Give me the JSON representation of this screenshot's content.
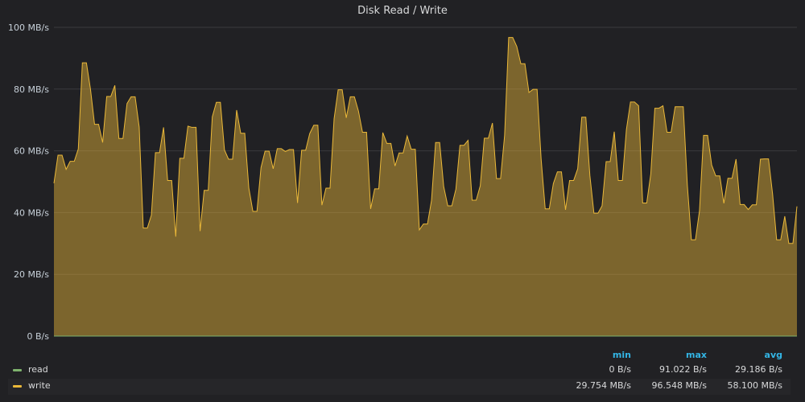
{
  "panel": {
    "title": "Disk Read / Write"
  },
  "legend": {
    "headers": {
      "min": "min",
      "max": "max",
      "avg": "avg"
    },
    "rows": [
      {
        "name": "read",
        "color": "#7eb26d",
        "min": "0 B/s",
        "max": "91.022 B/s",
        "avg": "29.186 B/s"
      },
      {
        "name": "write",
        "color": "#eab839",
        "min": "29.754 MB/s",
        "max": "96.548 MB/s",
        "avg": "58.100 MB/s"
      }
    ]
  },
  "chart_data": {
    "type": "area",
    "title": "Disk Read / Write",
    "ylabel": "",
    "ylim": [
      0,
      100
    ],
    "y_unit": "MB/s",
    "y_ticks": [
      "0 B/s",
      "20 MB/s",
      "40 MB/s",
      "60 MB/s",
      "80 MB/s",
      "100 MB/s"
    ],
    "grid": true,
    "legend_position": "bottom",
    "series": [
      {
        "name": "read",
        "color": "#7eb26d",
        "values": [
          0,
          0,
          0,
          0,
          0,
          0,
          0,
          0,
          0,
          0,
          0,
          0,
          0,
          0,
          0,
          0,
          0,
          0,
          0,
          0,
          0,
          0,
          0,
          0,
          0,
          0,
          0,
          0,
          0,
          0,
          0,
          0,
          0,
          0,
          0,
          0,
          0,
          0,
          0,
          0,
          0,
          0,
          0,
          0,
          0,
          0,
          0,
          0,
          0,
          0,
          0,
          0,
          0,
          0,
          0,
          0,
          0,
          0,
          0,
          0,
          0,
          0,
          0,
          0,
          0,
          0,
          0,
          0,
          0,
          0,
          0,
          0,
          0,
          0,
          0,
          0,
          0,
          0,
          0,
          0,
          0,
          0,
          0,
          0,
          0,
          0,
          0,
          0,
          0,
          0,
          0,
          0,
          0,
          0,
          0,
          0,
          0,
          0,
          0,
          0,
          0,
          0,
          0,
          0,
          0,
          0,
          0,
          0,
          0,
          0,
          0,
          0,
          0,
          0,
          0,
          0,
          0,
          0,
          0,
          0,
          0,
          0,
          0,
          0,
          0,
          0,
          0,
          0,
          0,
          0,
          0,
          0,
          0,
          0,
          0,
          0,
          0,
          0,
          0,
          0,
          0,
          0,
          0,
          0,
          0,
          0,
          0,
          0,
          0,
          0,
          0,
          0,
          0,
          0,
          0,
          0,
          0,
          0,
          0,
          0,
          0,
          0,
          0,
          0,
          0,
          0,
          0,
          0,
          0,
          0,
          0,
          0,
          0,
          0,
          0,
          0,
          0,
          0,
          0,
          0,
          0,
          0,
          0,
          0,
          0,
          0,
          0,
          0,
          0,
          0,
          0,
          0,
          0,
          0,
          0,
          0,
          0,
          0,
          0,
          0,
          0,
          0,
          0,
          0,
          0,
          0,
          0,
          0,
          0,
          0,
          0,
          0,
          0,
          0,
          0,
          0,
          0,
          0,
          0,
          0,
          0,
          0,
          0,
          0,
          0,
          0,
          0,
          0,
          0,
          0,
          0,
          0,
          0,
          0,
          0,
          0,
          0,
          0,
          0,
          0,
          0,
          0,
          0,
          0,
          0,
          0,
          0,
          0,
          0,
          0,
          0,
          0,
          0,
          0,
          0,
          0,
          0,
          0,
          0,
          0,
          0,
          0,
          0,
          0,
          0,
          0,
          0,
          0,
          0,
          0,
          0,
          0,
          0,
          0,
          0,
          0,
          0,
          0,
          0,
          0,
          0,
          0,
          0,
          0,
          0,
          0,
          0,
          0,
          0,
          0,
          0,
          0,
          0,
          0,
          0,
          0,
          0,
          0,
          0,
          0,
          0,
          0,
          0,
          0,
          0,
          0,
          0,
          0,
          0,
          0,
          0,
          0,
          0,
          0,
          0,
          0,
          0,
          0,
          0,
          0,
          0,
          0,
          0,
          0,
          0,
          0,
          0
        ]
      },
      {
        "name": "write",
        "color": "#eab839",
        "values": [
          49.5,
          58.6,
          58.6,
          54.0,
          56.6,
          56.6,
          60.6,
          88.5,
          88.5,
          80.0,
          68.6,
          68.6,
          62.7,
          77.6,
          77.6,
          81.2,
          64.0,
          64.0,
          75.3,
          77.5,
          77.5,
          67.7,
          35.0,
          35.0,
          39.2,
          59.4,
          59.4,
          67.6,
          50.4,
          50.4,
          32.2,
          57.6,
          57.6,
          68.0,
          67.6,
          67.6,
          34.0,
          47.2,
          47.2,
          71.0,
          75.7,
          75.7,
          60.3,
          57.3,
          57.3,
          73.2,
          65.7,
          65.7,
          48.0,
          40.4,
          40.4,
          54.6,
          59.9,
          59.9,
          54.2,
          60.7,
          60.7,
          59.8,
          60.4,
          60.4,
          43.1,
          60.2,
          60.2,
          65.6,
          68.3,
          68.3,
          42.4,
          47.9,
          47.9,
          70.4,
          79.8,
          79.8,
          70.7,
          77.5,
          77.5,
          72.9,
          66.0,
          66.0,
          41.2,
          47.7,
          47.7,
          65.9,
          62.4,
          62.4,
          55.1,
          59.3,
          59.3,
          64.8,
          60.5,
          60.5,
          34.4,
          36.3,
          36.3,
          44.0,
          62.7,
          62.7,
          48.4,
          42.2,
          42.2,
          47.6,
          61.8,
          61.8,
          63.4,
          44.0,
          44.0,
          48.7,
          64.1,
          64.1,
          69.0,
          51.0,
          51.0,
          65.0,
          96.7,
          96.7,
          93.8,
          88.2,
          88.2,
          78.9,
          79.9,
          79.9,
          57.2,
          41.2,
          41.2,
          49.4,
          53.2,
          53.2,
          40.9,
          50.4,
          50.4,
          54.2,
          70.9,
          70.9,
          52.0,
          39.8,
          39.8,
          42.2,
          56.5,
          56.5,
          66.2,
          50.4,
          50.4,
          66.9,
          75.8,
          75.8,
          74.6,
          43.1,
          43.1,
          52.5,
          73.8,
          73.8,
          74.6,
          66.0,
          66.0,
          74.3,
          74.3,
          74.3,
          49.0,
          31.2,
          31.2,
          40.6,
          65.0,
          65.0,
          55.4,
          51.9,
          51.9,
          43.0,
          51.1,
          51.1,
          57.3,
          42.6,
          42.6,
          41.0,
          42.5,
          42.5,
          57.3,
          57.4,
          57.4,
          46.0,
          31.2,
          31.2,
          38.8,
          30.0,
          30.0,
          42.0
        ]
      }
    ]
  }
}
